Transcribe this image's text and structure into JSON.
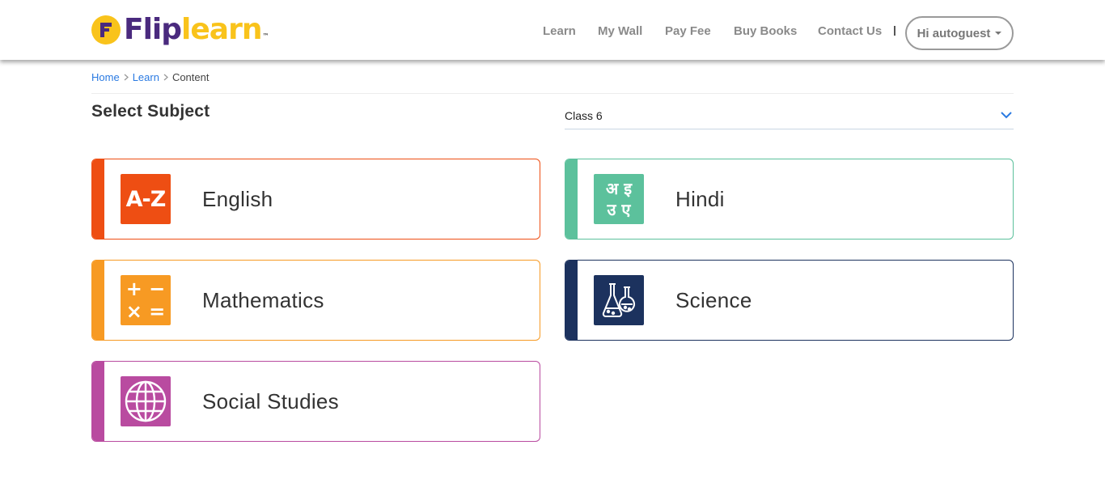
{
  "brand": {
    "name_part1": "Flip",
    "name_part2": "learn",
    "trademark": "™",
    "badge_letter": "F",
    "colors": {
      "primary": "#4a2a7e",
      "accent": "#f9c31b"
    }
  },
  "nav": {
    "items": [
      "Learn",
      "My Wall",
      "Pay Fee",
      "Buy Books",
      "Contact Us"
    ],
    "user_label": "Hi autoguest"
  },
  "breadcrumb": {
    "items": [
      "Home",
      "Learn"
    ],
    "current": "Content"
  },
  "page": {
    "title": "Select Subject",
    "class_select": {
      "value": "Class 6"
    }
  },
  "subjects": [
    {
      "label": "English",
      "icon": "a-z-icon",
      "icon_text": "A-Z",
      "color": "#ee4e13"
    },
    {
      "label": "Hindi",
      "icon": "hindi-letters-icon",
      "icon_text_line1": "अ इ",
      "icon_text_line2": "उ ए",
      "color": "#5cc19c"
    },
    {
      "label": "Mathematics",
      "icon": "math-operators-icon",
      "icon_text_line1": "+ −",
      "icon_text_line2": "× =",
      "color": "#f79a23"
    },
    {
      "label": "Science",
      "icon": "flask-icon",
      "color": "#1c325e"
    },
    {
      "label": "Social Studies",
      "icon": "globe-icon",
      "color": "#b94ba0"
    }
  ]
}
